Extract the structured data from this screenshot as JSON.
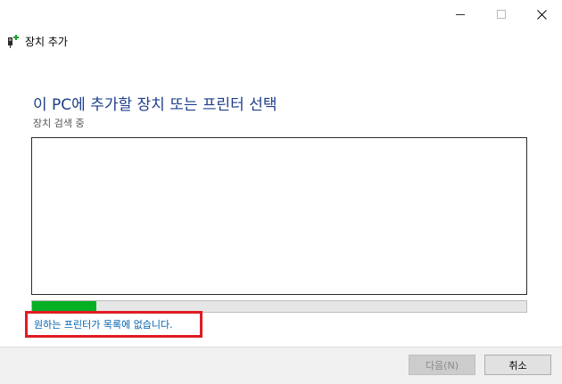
{
  "window": {
    "title": "장치 추가",
    "controls": {
      "minimize": "minimize",
      "maximize": "maximize",
      "close": "close"
    }
  },
  "main": {
    "heading": "이 PC에 추가할 장치 또는 프린터 선택",
    "status": "장치 검색 중",
    "device_list": [],
    "progress": {
      "value_percent": 13,
      "color": "#06b025"
    },
    "printer_not_listed_link": "원하는 프린터가 목록에 없습니다."
  },
  "footer": {
    "next_label": "다음(N)",
    "cancel_label": "취소"
  },
  "colors": {
    "heading": "#1e3f8b",
    "link": "#0063b1",
    "highlight": "#e11b22"
  }
}
